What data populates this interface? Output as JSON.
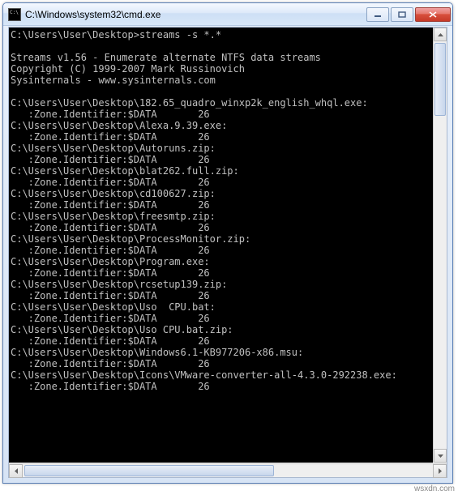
{
  "window": {
    "title": "C:\\Windows\\system32\\cmd.exe"
  },
  "terminal": {
    "prompt": "C:\\Users\\User\\Desktop>",
    "command": "streams -s *.*",
    "header": [
      "Streams v1.56 - Enumerate alternate NTFS data streams",
      "Copyright (C) 1999-2007 Mark Russinovich",
      "Sysinternals - www.sysinternals.com"
    ],
    "basePath": "C:\\Users\\User\\Desktop\\",
    "streamLine": "   :Zone.Identifier:$DATA       26",
    "files": [
      "182.65_quadro_winxp2k_english_whql.exe",
      "Alexa.9.39.exe",
      "Autoruns.zip",
      "blat262.full.zip",
      "cd100627.zip",
      "freesmtp.zip",
      "ProcessMonitor.zip",
      "Program.exe",
      "rcsetup139.zip",
      "Uso  CPU.bat",
      "Uso CPU.bat.zip",
      "Windows6.1-KB977206-x86.msu",
      "Icons\\VMware-converter-all-4.3.0-292238.exe"
    ]
  },
  "watermark": "wsxdn.com"
}
